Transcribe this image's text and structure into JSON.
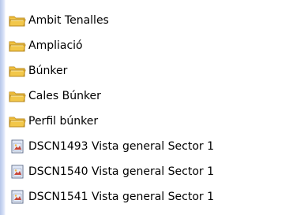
{
  "file_list": {
    "items": [
      {
        "label": "Ambit Tenalles",
        "type": "folder",
        "icon": "folder-icon"
      },
      {
        "label": "Ampliació",
        "type": "folder",
        "icon": "folder-icon"
      },
      {
        "label": "Búnker",
        "type": "folder",
        "icon": "folder-icon"
      },
      {
        "label": "Cales Búnker",
        "type": "folder",
        "icon": "folder-icon"
      },
      {
        "label": "Perfil búnker",
        "type": "folder",
        "icon": "folder-icon"
      },
      {
        "label": "DSCN1493 Vista general Sector 1",
        "type": "image",
        "icon": "image-file-icon"
      },
      {
        "label": "DSCN1540 Vista general Sector 1",
        "type": "image",
        "icon": "image-file-icon"
      },
      {
        "label": "DSCN1541 Vista general Sector 1",
        "type": "image",
        "icon": "image-file-icon"
      }
    ]
  },
  "colors": {
    "folder_body": "#f2c74a",
    "folder_tab": "#e9b531",
    "folder_outline": "#b98a1f",
    "image_file_border": "#5f6f8f",
    "image_file_accent": "#c63a2a"
  }
}
